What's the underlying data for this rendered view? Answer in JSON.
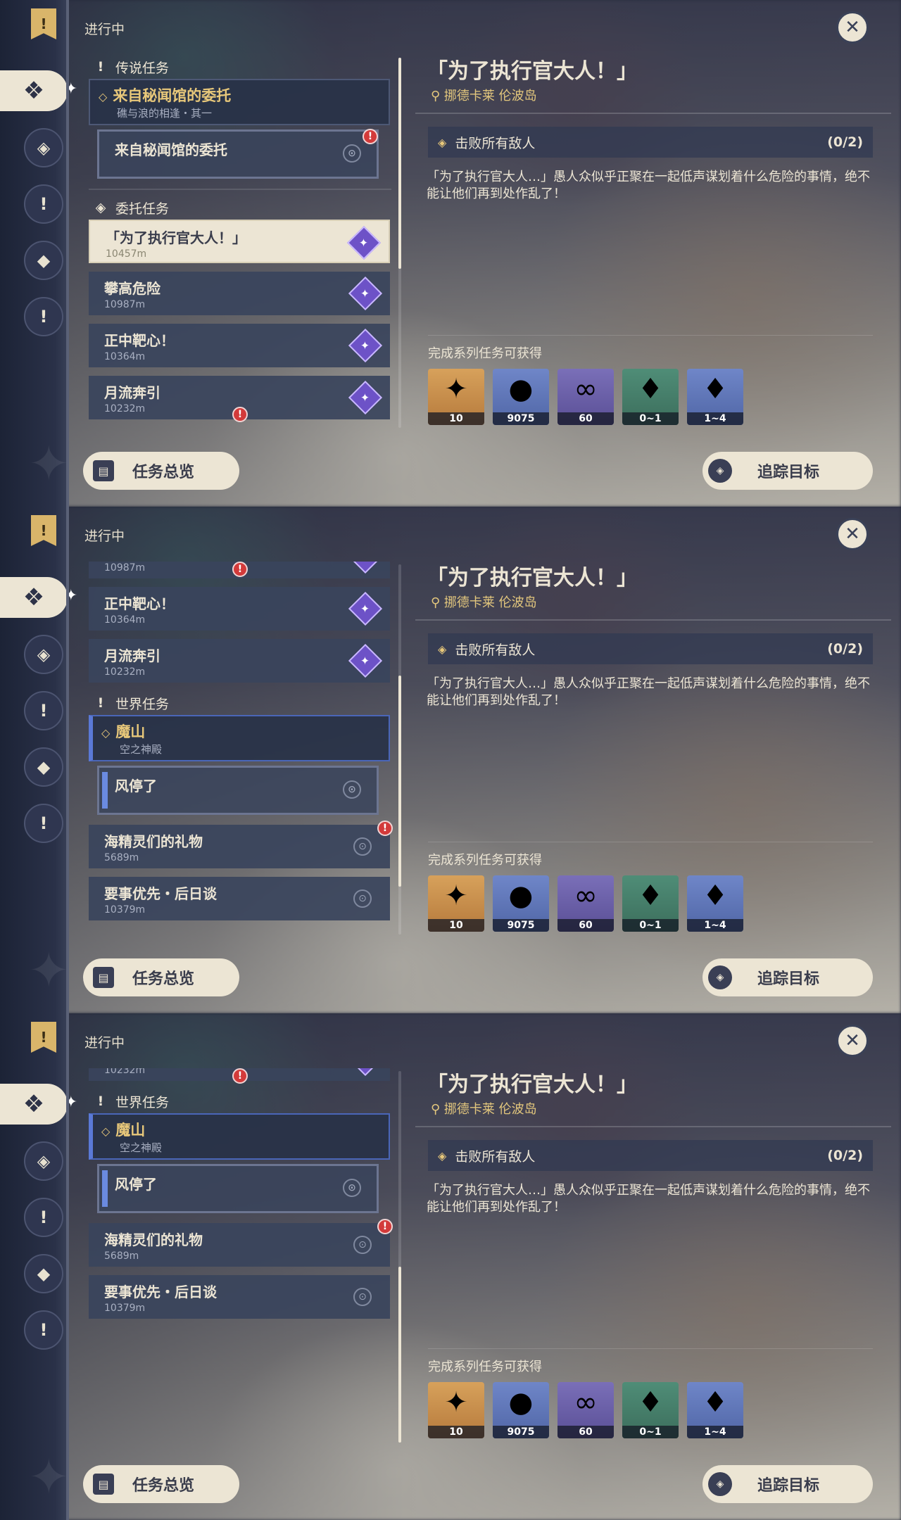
{
  "header": {
    "status": "进行中"
  },
  "detail": {
    "title": "「为了执行官大人！」",
    "location": "挪德卡莱 伦波岛",
    "objective": {
      "label": "击败所有敌人",
      "count": "(0/2)"
    },
    "description": "「为了执行官大人…」愚人众似乎正聚在一起低声谋划着什么危险的事情，绝不能让他们再到处作乱了！",
    "rewards_label": "完成系列任务可获得",
    "rewards": [
      {
        "icon": "primogem-icon",
        "qty": "10"
      },
      {
        "icon": "mora-icon",
        "qty": "9075"
      },
      {
        "icon": "intertwined-fate-icon",
        "qty": "60"
      },
      {
        "icon": "crystal-green-icon",
        "qty": "0~1"
      },
      {
        "icon": "crystal-purple-icon",
        "qty": "1~4"
      }
    ]
  },
  "buttons": {
    "overview": "任务总览",
    "track": "追踪目标"
  },
  "sections": {
    "legend": "传说任务",
    "commission": "委托任务",
    "world": "世界任务"
  },
  "legend_group": {
    "title": "来自秘闻馆的委托",
    "subtitle": "礁与浪的相逢・其一",
    "sub_item": "来自秘闻馆的委托"
  },
  "commissions": [
    {
      "title": "「为了执行官大人！」",
      "dist": "10457m"
    },
    {
      "title": "攀高危险",
      "dist": "10987m"
    },
    {
      "title": "正中靶心！",
      "dist": "10364m"
    },
    {
      "title": "月流奔引",
      "dist": "10232m"
    }
  ],
  "world_group": {
    "title": "魔山",
    "subtitle": "空之神殿",
    "sub_item": "风停了"
  },
  "world_items": [
    {
      "title": "海精灵们的礼物",
      "dist": "5689m"
    },
    {
      "title": "要事优先・后日谈",
      "dist": "10379m"
    }
  ],
  "colors": {
    "accent_cream": "#ece5d4",
    "gold": "#e3c77d",
    "panel": "#3a445c",
    "alert": "#d33a3a",
    "purple": "#6d52c7"
  }
}
